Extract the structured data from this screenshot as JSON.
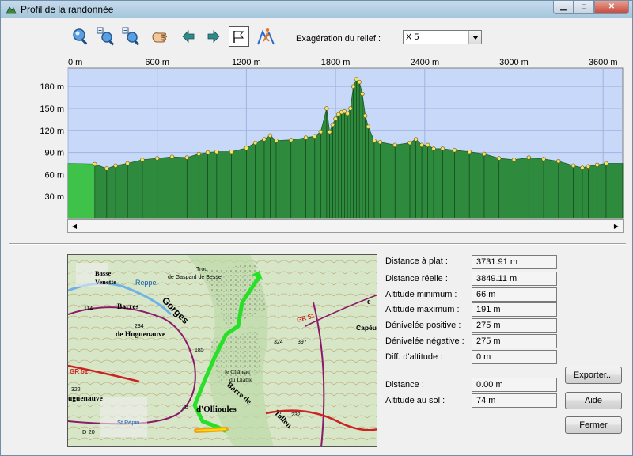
{
  "window": {
    "title": "Profil de la randonnée"
  },
  "toolbar": {
    "tools": [
      {
        "name": "zoom-fit-icon"
      },
      {
        "name": "zoom-in-icon"
      },
      {
        "name": "zoom-out-icon"
      },
      {
        "name": "pan-hand-icon"
      },
      {
        "name": "arrow-left-icon"
      },
      {
        "name": "arrow-right-icon"
      },
      {
        "name": "flag-icon"
      },
      {
        "name": "hiker-icon"
      }
    ],
    "relief_label": "Exagération du relief :",
    "relief_value": "X 5"
  },
  "chart_data": {
    "type": "area",
    "xlabel": "",
    "ylabel": "",
    "x_ticks": [
      "0 m",
      "600 m",
      "1200 m",
      "1800 m",
      "2400 m",
      "3000 m",
      "3600 m"
    ],
    "x_tick_values": [
      0,
      600,
      1200,
      1800,
      2400,
      3000,
      3600
    ],
    "y_ticks": [
      "30 m",
      "60 m",
      "90 m",
      "120 m",
      "150 m",
      "180 m"
    ],
    "y_tick_values": [
      30,
      60,
      90,
      120,
      150,
      180
    ],
    "xlim": [
      0,
      3732
    ],
    "ylim": [
      0,
      205
    ],
    "grid": true,
    "colors": {
      "background": "#c8d8f8",
      "fill": "#2e8b3e",
      "fill_start": "#3ec24a",
      "point": "#f3e36a",
      "grid": "#9fb3e0"
    },
    "x": [
      0,
      180,
      260,
      320,
      400,
      500,
      600,
      700,
      800,
      880,
      940,
      1000,
      1100,
      1200,
      1260,
      1320,
      1360,
      1400,
      1500,
      1600,
      1660,
      1700,
      1740,
      1760,
      1780,
      1800,
      1820,
      1840,
      1860,
      1880,
      1900,
      1920,
      1940,
      1960,
      1980,
      2000,
      2020,
      2060,
      2100,
      2200,
      2300,
      2340,
      2380,
      2420,
      2460,
      2520,
      2600,
      2700,
      2800,
      2900,
      3000,
      3100,
      3200,
      3300,
      3400,
      3460,
      3500,
      3560,
      3620,
      3732
    ],
    "y": [
      75,
      74,
      68,
      72,
      75,
      80,
      82,
      84,
      83,
      88,
      90,
      91,
      91,
      96,
      103,
      108,
      113,
      106,
      107,
      110,
      112,
      118,
      150,
      118,
      128,
      136,
      142,
      145,
      146,
      143,
      150,
      180,
      190,
      186,
      170,
      140,
      125,
      106,
      104,
      100,
      103,
      108,
      100,
      100,
      95,
      95,
      93,
      91,
      88,
      82,
      80,
      83,
      81,
      78,
      72,
      69,
      71,
      73,
      75,
      75
    ]
  },
  "map": {
    "labels": {
      "basse_venette": "Basse\nVenette",
      "reppe": "Reppe",
      "gorges": "Gorges",
      "barres": "Barres",
      "de_huguenauve": "de Huguenauve",
      "num234": "234",
      "num114": "114",
      "trou": "Trou",
      "de_gaspard": "de Gaspard de Besse",
      "chateau": "le Château",
      "du_diable": "du Diable",
      "gr51_a": "GR 51",
      "gr51_b": "GR 51",
      "capeu": "Capéu",
      "num324": "324",
      "num397": "397",
      "olioules": "d'Ollioules",
      "barre_de": "Barre de",
      "tollon": "Tollon",
      "num232": "232",
      "num322": "322",
      "huguenauve2": "uguenauve",
      "d20": "D 20",
      "st_pepin": "St Pépin",
      "num185": "185",
      "num28": "28",
      "letter_e": "e"
    }
  },
  "stats": [
    {
      "label": "Distance à plat :",
      "value": "3731.91 m"
    },
    {
      "label": "Distance réelle :",
      "value": "3849.11 m"
    },
    {
      "label": "Altitude minimum :",
      "value": "66 m"
    },
    {
      "label": "Altitude maximum :",
      "value": "191 m"
    },
    {
      "label": "Dénivelée positive :",
      "value": "275 m"
    },
    {
      "label": "Dénivelée négative :",
      "value": "275 m"
    },
    {
      "label": "Diff. d'altitude :",
      "value": "0 m"
    }
  ],
  "cursor": [
    {
      "label": "Distance :",
      "value": "0.00 m"
    },
    {
      "label": "Altitude au sol :",
      "value": "74 m"
    }
  ],
  "buttons": {
    "export": "Exporter...",
    "help": "Aide",
    "close": "Fermer"
  }
}
